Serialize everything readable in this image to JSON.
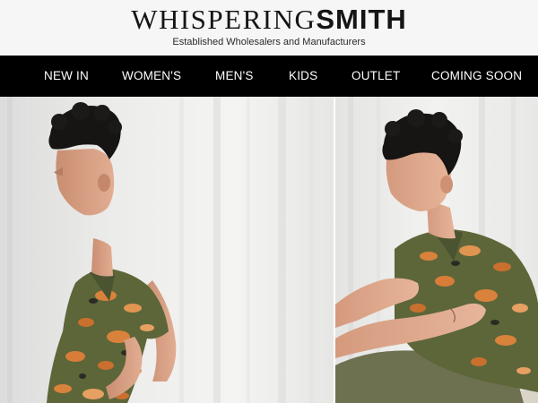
{
  "header": {
    "logo_light": "WHISPERING",
    "logo_bold": "SMITH",
    "tagline": "Established Wholesalers and Manufacturers"
  },
  "nav": {
    "items": [
      {
        "label": "NEW IN"
      },
      {
        "label": "WOMEN'S"
      },
      {
        "label": "MEN'S"
      },
      {
        "label": "KIDS"
      },
      {
        "label": "OUTLET"
      },
      {
        "label": "COMING SOON"
      }
    ]
  },
  "colors": {
    "header_bg": "#f6f6f6",
    "nav_bg": "#000000",
    "nav_text": "#ffffff",
    "shirt_green": "#5d6639",
    "tiger_orange": "#d9823b"
  }
}
